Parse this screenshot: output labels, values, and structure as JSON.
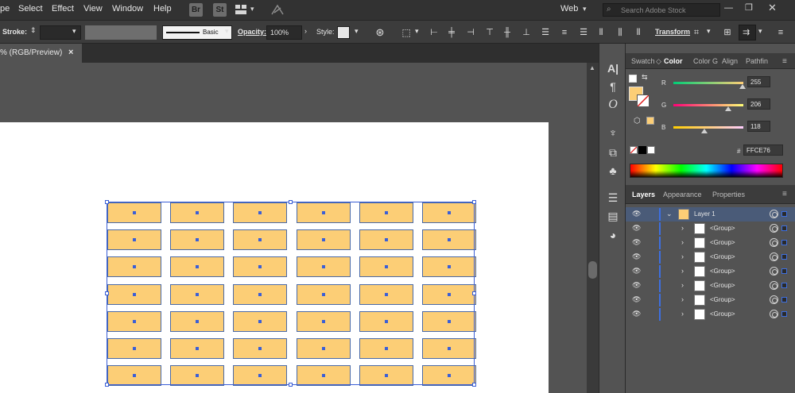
{
  "menubar": {
    "items": [
      "pe",
      "Select",
      "Effect",
      "View",
      "Window",
      "Help"
    ],
    "bridge_badge": "Br",
    "stock_badge": "St",
    "workspace": "Web",
    "search_placeholder": "Search Adobe Stock"
  },
  "control_bar": {
    "stroke_label": "Stroke:",
    "brush_label": "Basic",
    "opacity_label": "Opacity:",
    "opacity_value": "100%",
    "style_label": "Style:",
    "transform_label": "Transform"
  },
  "document": {
    "tab_title": "% (RGB/Preview)",
    "close_glyph": "×"
  },
  "artwork": {
    "rows": 7,
    "cols": 6,
    "fill_color": "#fcce76",
    "stroke_color": "#4a6aa8"
  },
  "color_panel": {
    "tabs": [
      "Swatch",
      "Color",
      "Color G",
      "Align",
      "Pathfin"
    ],
    "active_tab": "Color",
    "r_label": "R",
    "g_label": "G",
    "b_label": "B",
    "r_value": "255",
    "g_value": "206",
    "b_value": "118",
    "hex_label": "#",
    "hex_value": "FFCE76",
    "fill_color": "#fcce76"
  },
  "layers_panel": {
    "tabs": [
      "Layers",
      "Appearance",
      "Properties"
    ],
    "active_tab": "Layers",
    "layer_name": "Layer 1",
    "group_label": "<Group>",
    "group_count": 7
  }
}
